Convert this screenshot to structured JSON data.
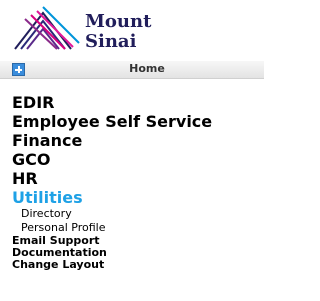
{
  "logo": {
    "line1": "Mount",
    "line2": "Sinai"
  },
  "header": {
    "home_label": "Home"
  },
  "menu": {
    "primary": [
      "EDIR",
      "Employee Self Service",
      "Finance",
      "GCO",
      "HR"
    ],
    "active": "Utilities",
    "submenu": [
      "Directory",
      "Personal Profile"
    ],
    "secondary": [
      "Email Support",
      "Documentation",
      "Change Layout"
    ]
  },
  "colors": {
    "active": "#1ea1e6",
    "brand_navy": "#211e5b",
    "brand_magenta": "#d6007f"
  }
}
